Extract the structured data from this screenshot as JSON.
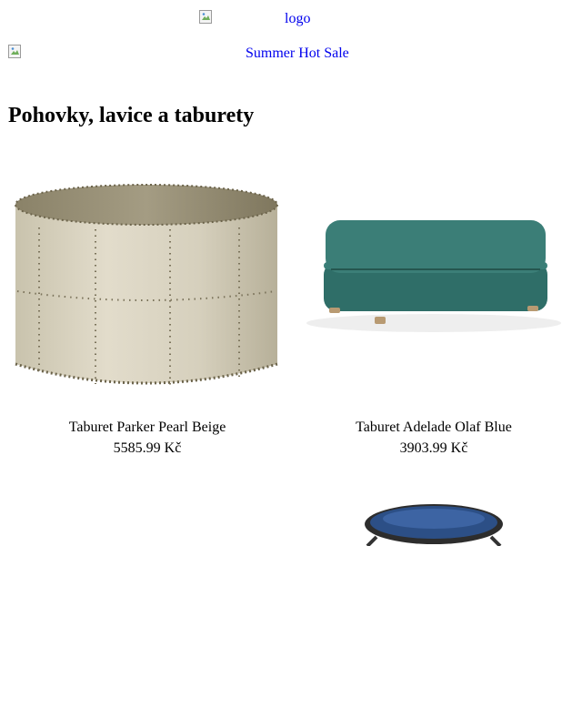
{
  "header": {
    "logo_alt": "logo",
    "banner_alt": "Summer Hot Sale"
  },
  "category": {
    "title": "Pohovky, lavice a taburety"
  },
  "products": [
    {
      "name": "Taburet Parker Pearl Beige",
      "price": "5585.99 Kč",
      "image": "beige-round-studded-ottoman"
    },
    {
      "name": "Taburet Adelade Olaf Blue",
      "price": "3903.99 Kč",
      "image": "teal-upholstered-ottoman"
    },
    {
      "name": "",
      "price": "",
      "image": "blue-velvet-metal-stool"
    }
  ]
}
